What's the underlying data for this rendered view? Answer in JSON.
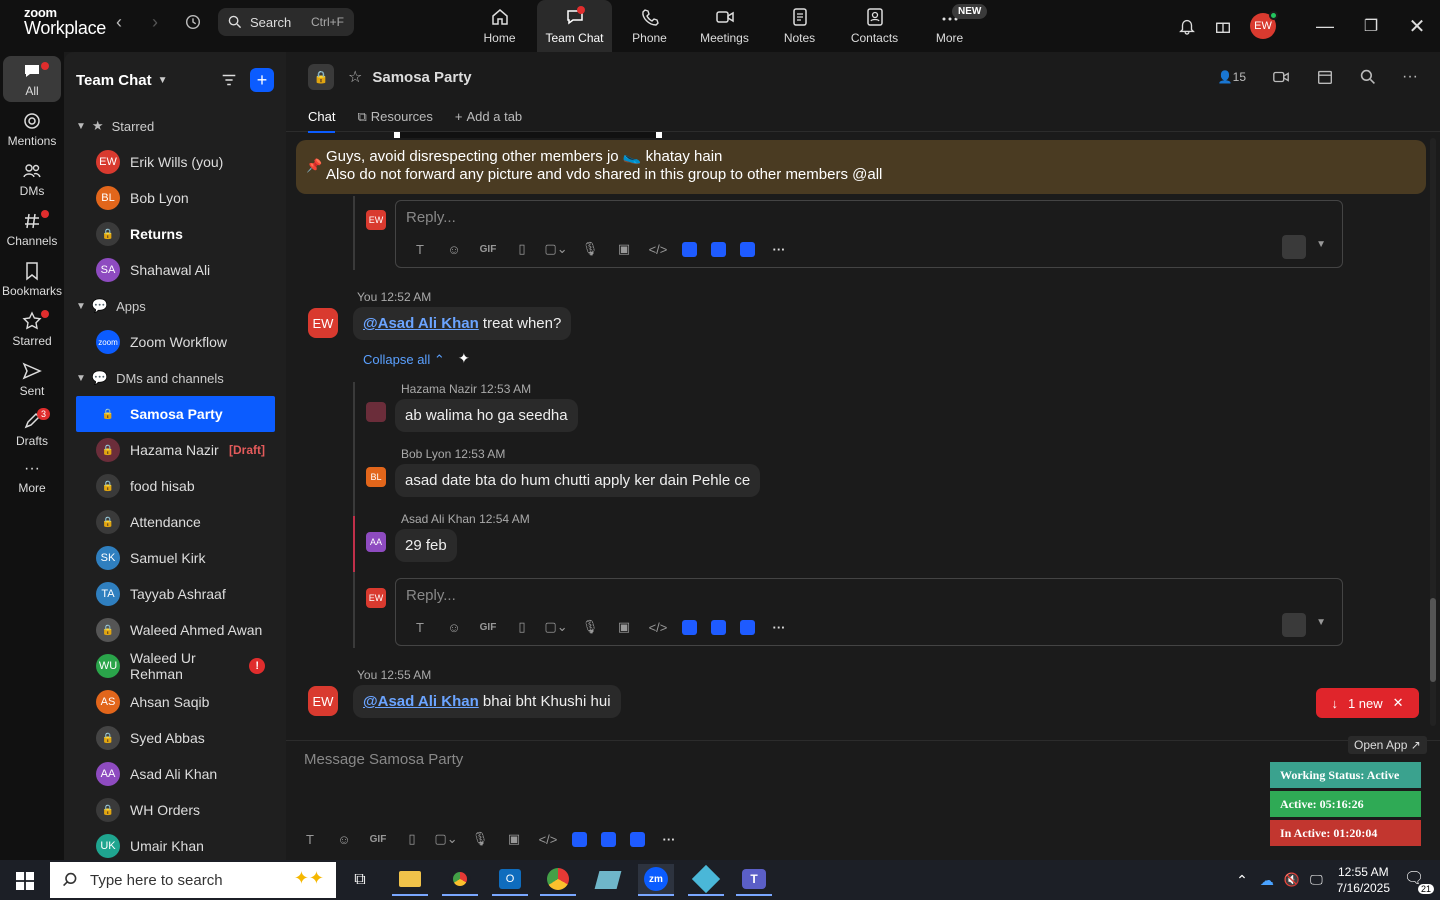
{
  "app": {
    "logo_line1": "zoom",
    "logo_line2": "Workplace",
    "search_label": "Search",
    "search_shortcut": "Ctrl+F",
    "user_initials": "EW"
  },
  "nav": [
    {
      "label": "Home",
      "icon": "home-icon"
    },
    {
      "label": "Team Chat",
      "icon": "chat-icon"
    },
    {
      "label": "Phone",
      "icon": "phone-icon"
    },
    {
      "label": "Meetings",
      "icon": "video-icon"
    },
    {
      "label": "Notes",
      "icon": "notes-icon"
    },
    {
      "label": "Contacts",
      "icon": "contacts-icon"
    },
    {
      "label": "More",
      "icon": "more-icon",
      "badge": "NEW"
    }
  ],
  "rail": [
    {
      "label": "All"
    },
    {
      "label": "Mentions"
    },
    {
      "label": "DMs"
    },
    {
      "label": "Channels"
    },
    {
      "label": "Bookmarks"
    },
    {
      "label": "Starred"
    },
    {
      "label": "Sent"
    },
    {
      "label": "Drafts",
      "badge": "3"
    },
    {
      "label": "More"
    }
  ],
  "sidebar": {
    "title": "Team Chat",
    "sections": {
      "starred": "Starred",
      "apps": "Apps",
      "dms": "DMs and channels"
    },
    "starred": [
      {
        "initials": "EW",
        "name": "Erik Wills (you)",
        "color": "#d93a2f"
      },
      {
        "initials": "BL",
        "name": "Bob Lyon",
        "color": "#e2661b"
      },
      {
        "initials": "",
        "name": "Returns",
        "color": "#3a3a3a"
      },
      {
        "initials": "SA",
        "name": "Shahawal Ali",
        "color": "#8e4bc0"
      }
    ],
    "apps": [
      {
        "initials": "zoom",
        "name": "Zoom Workflow",
        "color": "#0b5cff"
      }
    ],
    "dms": [
      {
        "initials": "",
        "name": "Samosa Party",
        "color": "#0b5cff"
      },
      {
        "initials": "",
        "name": "Hazama Nazir",
        "color": "#6b2d3a",
        "draft": "[Draft]"
      },
      {
        "initials": "",
        "name": "food hisab",
        "color": "#3a3a3a"
      },
      {
        "initials": "",
        "name": "Attendance",
        "color": "#3a3a3a"
      },
      {
        "initials": "SK",
        "name": "Samuel Kirk",
        "color": "#2f7fbf"
      },
      {
        "initials": "TA",
        "name": "Tayyab Ashraaf",
        "color": "#2f7fbf"
      },
      {
        "initials": "",
        "name": "Waleed Ahmed Awan",
        "color": "#555555"
      },
      {
        "initials": "WU",
        "name": "Waleed Ur Rehman",
        "color": "#2aa44a",
        "alert": "!"
      },
      {
        "initials": "AS",
        "name": "Ahsan Saqib",
        "color": "#e2661b"
      },
      {
        "initials": "",
        "name": "Syed Abbas",
        "color": "#444444"
      },
      {
        "initials": "AA",
        "name": "Asad Ali Khan",
        "color": "#8e4bc0"
      },
      {
        "initials": "",
        "name": "WH Orders",
        "color": "#3a3a3a"
      },
      {
        "initials": "UK",
        "name": "Umair Khan",
        "color": "#1fa58f"
      }
    ]
  },
  "channel": {
    "name": "Samosa Party",
    "member_count": "15",
    "tabs": [
      "Chat",
      "Resources",
      "Add a tab"
    ]
  },
  "pinned": {
    "line1": "Guys, avoid disrespecting other members jo 🥿 khatay hain",
    "line2": "Also do not forward any picture and vdo shared in this group to other members @all"
  },
  "reply_placeholder": "Reply...",
  "messages": [
    {
      "sender": "You",
      "time": "12:52 AM",
      "mention": "@Asad Ali Khan",
      "text": " treat when?",
      "initials": "EW"
    },
    {
      "sender": "You",
      "time": "12:55 AM",
      "mention": "@Asad Ali Khan",
      "text": " bhai bht Khushi hui",
      "initials": "EW"
    }
  ],
  "collapse_label": "Collapse all",
  "thread": [
    {
      "sender": "Hazama Nazir",
      "time": "12:53 AM",
      "text": "ab walima ho ga seedha",
      "initials": "",
      "color": "#6b2d3a"
    },
    {
      "sender": "Bob Lyon",
      "time": "12:53 AM",
      "text": "asad date bta do hum chutti apply ker dain Pehle ce",
      "initials": "BL",
      "color": "#e2661b"
    },
    {
      "sender": "Asad Ali Khan",
      "time": "12:54 AM",
      "text": "29 feb",
      "initials": "AA",
      "color": "#8e4bc0"
    }
  ],
  "new_messages": "1 new",
  "composer_placeholder": "Message Samosa Party",
  "widget": {
    "open_app": "Open App ↗",
    "working": "Working Status: Active",
    "active": "Active: 05:16:26",
    "inactive": "In Active: 01:20:04",
    "colors": {
      "working": "#3aa28e",
      "active": "#2faa55",
      "inactive": "#c2362f"
    }
  },
  "taskbar": {
    "search_placeholder": "Type here to search",
    "time": "12:55 AM",
    "date": "7/16/2025",
    "notifications": "21"
  }
}
